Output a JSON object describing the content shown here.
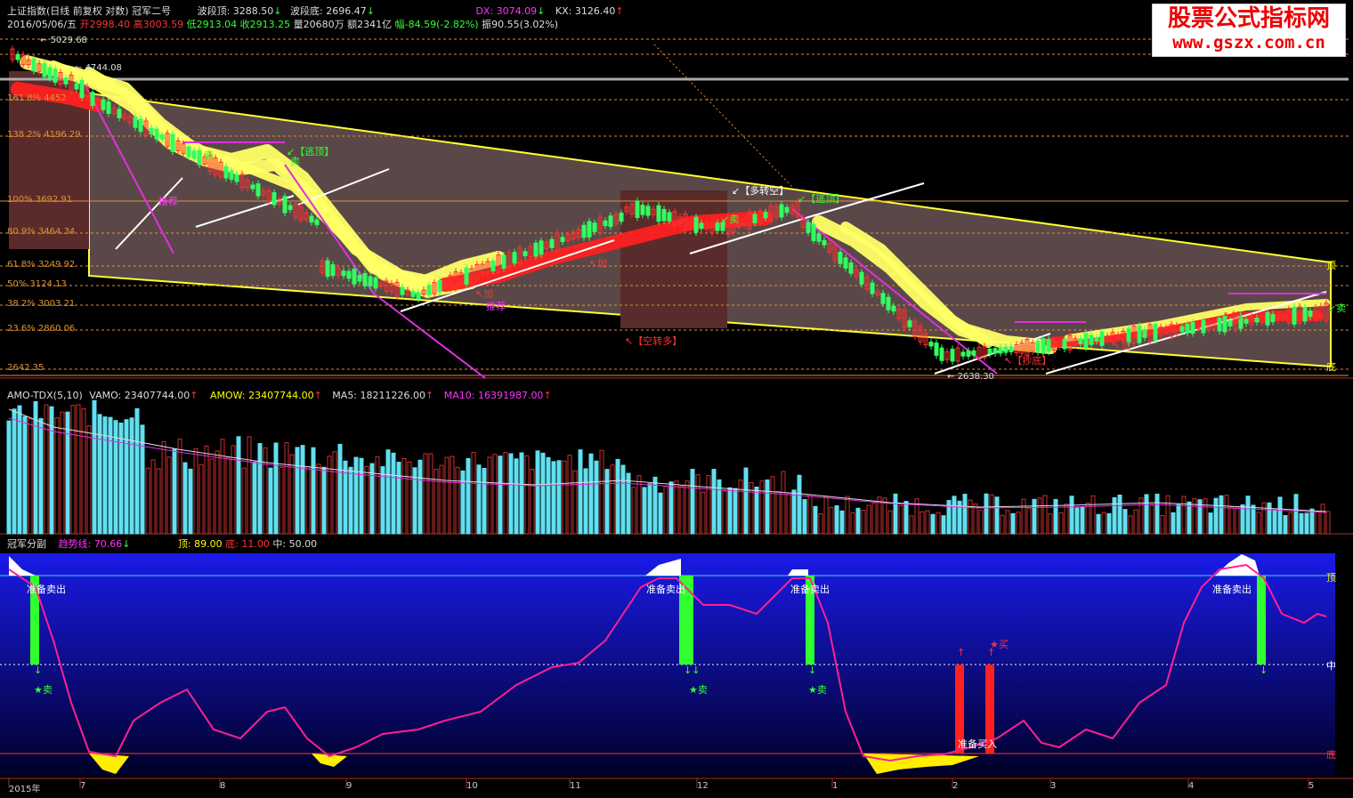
{
  "header": {
    "title": "上证指数(日线 前复权 对数) 冠军二号",
    "wave_top_label": "波段顶:",
    "wave_top_value": "3288.50",
    "wave_bottom_label": "波段底:",
    "wave_bottom_value": "2696.47",
    "dx_label": "DX:",
    "dx_value": "3074.09",
    "kx_label": "KX:",
    "kx_value": "3126.40",
    "date": "2016/05/06/五",
    "open_label": "开",
    "open": "2998.40",
    "high_label": "高",
    "high": "3003.59",
    "low_label": "低",
    "low": "2913.04",
    "close_label": "收",
    "close": "2913.25",
    "volume_label": "量",
    "volume": "20680万",
    "amount_label": "额",
    "amount": "2341亿",
    "change_label": "幅",
    "change": "-84.59(-2.82%)",
    "amp_label": "振",
    "amp": "90.55(3.02%)"
  },
  "watermark": {
    "line1": "股票公式指标网",
    "line2": "www.gszx.com.cn"
  },
  "main_chart": {
    "price_marks": [
      "5029.68",
      "4744.08",
      "2638.30"
    ],
    "fib_levels": [
      {
        "label": "161.8%",
        "value": "4452"
      },
      {
        "label": "138.2%",
        "value": "4196.29"
      },
      {
        "label": "100%",
        "value": "3692.91"
      },
      {
        "label": "80.9%",
        "value": "3464.34"
      },
      {
        "label": "61.8%",
        "value": "3249.92"
      },
      {
        "label": "50%",
        "value": "3124.13"
      },
      {
        "label": "38.2%",
        "value": "3003.21"
      },
      {
        "label": "23.6%",
        "value": "2860.06"
      },
      {
        "label": "",
        "value": "2642.35"
      }
    ],
    "signals": {
      "escape_top_1": "【逃顶】",
      "escape_top_2": "【逃顶】",
      "long_to_short": "【多转空】",
      "short_to_long": "【空转多】",
      "sell": "卖",
      "add": "加",
      "recommend": "推荐",
      "bottom_buy": "【抄底】"
    },
    "right_labels": {
      "top": "顶",
      "bottom": "底"
    }
  },
  "volume_panel": {
    "indicator": "AMO-TDX(5,10)",
    "vamo_label": "VAMO:",
    "vamo": "23407744.00",
    "amow_label": "AMOW:",
    "amow": "23407744.00",
    "ma5_label": "MA5:",
    "ma5": "18211226.00",
    "ma10_label": "MA10:",
    "ma10": "16391987.00"
  },
  "osc_panel": {
    "name": "冠军分副",
    "trend_label": "趋势线:",
    "trend": "70.66",
    "top_label": "顶:",
    "top": "89.00",
    "bottom_label": "底:",
    "bottom": "11.00",
    "mid_label": "中:",
    "mid": "50.00",
    "ready_sell": "准备卖出",
    "ready_buy": "准备买入",
    "sell_star": "★卖",
    "buy_star": "★买",
    "right_top": "顶",
    "right_mid": "中",
    "right_bottom": "底"
  },
  "time_axis": {
    "labels": [
      "2015年",
      "7",
      "8",
      "9",
      "10",
      "11",
      "12",
      "1",
      "2",
      "3",
      "4",
      "5"
    ]
  },
  "colors": {
    "band_yellow": "#ffff66",
    "band_red": "#ff2020",
    "channel_fill": "#5a4848",
    "osc_bg_top": "#1a1ae0",
    "osc_bg_bottom": "#000030",
    "volume_up": "#c83030",
    "volume_down": "#60e0f0"
  }
}
